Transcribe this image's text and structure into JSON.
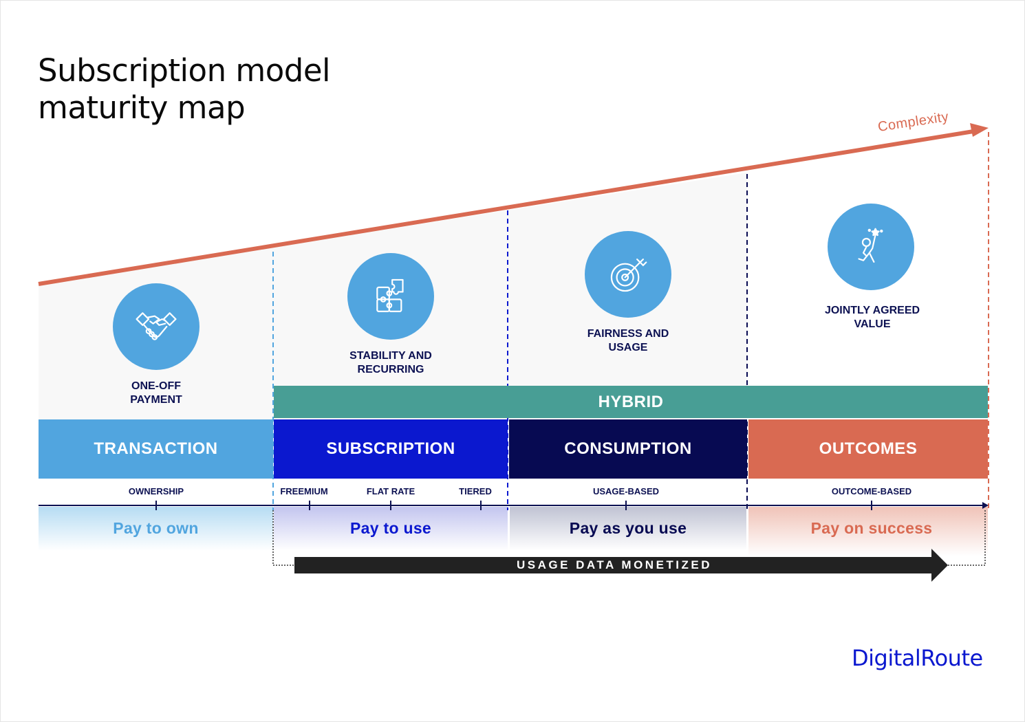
{
  "title": "Subscription model maturity map",
  "complexity_label": "Complexity",
  "stages": [
    {
      "caption": "ONE-OFF PAYMENT",
      "icon": "handshake-icon"
    },
    {
      "caption": "STABILITY AND RECURRING",
      "icon": "puzzle-icon"
    },
    {
      "caption": "FAIRNESS AND USAGE",
      "icon": "target-icon"
    },
    {
      "caption": "JOINTLY AGREED VALUE",
      "icon": "reaching-star-icon"
    }
  ],
  "hybrid_label": "HYBRID",
  "segments": [
    {
      "label": "TRANSACTION",
      "color": "#51a5df"
    },
    {
      "label": "SUBSCRIPTION",
      "color": "#0b18cf"
    },
    {
      "label": "CONSUMPTION",
      "color": "#070a52"
    },
    {
      "label": "OUTCOMES",
      "color": "#d96a52"
    }
  ],
  "ticks": [
    "OWNERSHIP",
    "FREEMIUM",
    "FLAT RATE",
    "TIERED",
    "USAGE-BASED",
    "OUTCOME-BASED"
  ],
  "pay_labels": [
    {
      "text": "Pay to own",
      "color": "#51a5df"
    },
    {
      "text": "Pay to use",
      "color": "#0b18cf"
    },
    {
      "text": "Pay as you use",
      "color": "#070a52"
    },
    {
      "text": "Pay on success",
      "color": "#d96a52"
    }
  ],
  "usage_arrow_label": "USAGE DATA MONETIZED",
  "brand": "DigitalRoute",
  "colors": {
    "complexity": "#d96a52",
    "hybrid": "#489e95",
    "icon_circle": "#51a5df",
    "caption_text": "#0c1152"
  }
}
